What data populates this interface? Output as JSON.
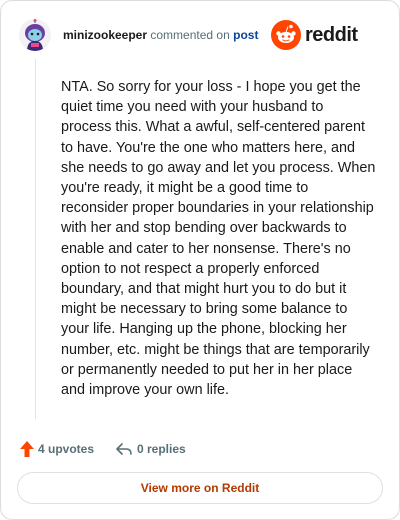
{
  "comment": {
    "username": "minizookeeper",
    "action_text": "commented on",
    "post_link": "post",
    "body": "NTA. So sorry for your loss - I hope you get the quiet time you need with your husband to process this. What a awful, self-centered parent to have. You're the one who matters here, and she needs to go away and let you process. When you're ready, it might be a good time to reconsider proper boundaries in your relationship with her and stop bending over backwards to enable and cater to her nonsense. There's no option to not respect a properly enforced boundary, and that might hurt you to do but it might be necessary to bring some balance to your life. Hanging up the phone, blocking her number, etc. might be things that are temporarily or permanently needed to put her in her place and improve your own life."
  },
  "brand": {
    "name": "reddit",
    "color": "#ff4500"
  },
  "actions": {
    "upvotes": "4 upvotes",
    "replies": "0 replies",
    "upvote_icon": "arrow-up-icon",
    "reply_icon": "reply-arrow-icon"
  },
  "footer": {
    "view_more": "View more on Reddit",
    "color": "#b33a00"
  }
}
